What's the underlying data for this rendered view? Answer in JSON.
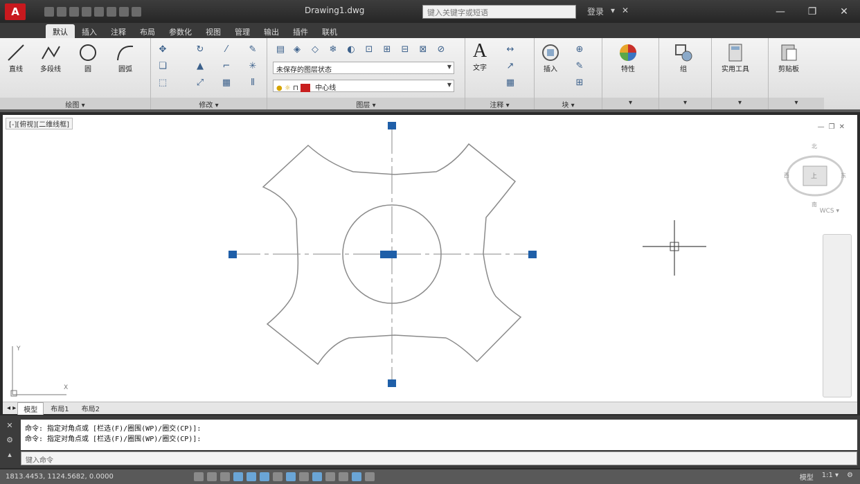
{
  "titlebar": {
    "app_logo": "A",
    "window_title": "Drawing1.dwg",
    "search_placeholder": "键入关键字或短语",
    "tools": [
      "登录",
      "▾",
      "✕"
    ],
    "controls": [
      "—",
      "❐",
      "✕"
    ]
  },
  "tabs": [
    {
      "label": "默认",
      "active": true
    },
    {
      "label": "插入",
      "active": false
    },
    {
      "label": "注释",
      "active": false
    },
    {
      "label": "布局",
      "active": false
    },
    {
      "label": "参数化",
      "active": false
    },
    {
      "label": "视图",
      "active": false
    },
    {
      "label": "管理",
      "active": false
    },
    {
      "label": "输出",
      "active": false
    },
    {
      "label": "插件",
      "active": false
    },
    {
      "label": "联机",
      "active": false
    }
  ],
  "ribbon": {
    "draw": {
      "title": "绘图 ▾",
      "line": "直线",
      "polyline": "多段线",
      "circle": "圆",
      "arc": "圆弧"
    },
    "modify": {
      "title": "修改 ▾"
    },
    "layers": {
      "title": "图层 ▾",
      "layer_combo": "未保存的图层状态",
      "current_layer": "中心线"
    },
    "annotation": {
      "title": "注释 ▾",
      "text": "文字"
    },
    "block": {
      "title": "块 ▾",
      "insert": "插入"
    },
    "properties": {
      "title": "▾",
      "label": "特性"
    },
    "groups": {
      "title": "▾",
      "label": "组"
    },
    "utilities": {
      "title": "▾",
      "label": "实用工具"
    },
    "clipboard": {
      "title": "▾",
      "label": "剪贴板"
    }
  },
  "canvas": {
    "viewport_label": "[-][俯视][二维线框]",
    "view_ctrls": [
      "—",
      "❐",
      "✕"
    ],
    "viewcube_top": "北",
    "viewcube_face": "上",
    "viewcube_bottom": "南",
    "viewcube_left": "西",
    "viewcube_right": "东",
    "wcs": "WCS ▾",
    "ucs_y": "Y",
    "ucs_x": "X"
  },
  "layout_tabs": [
    {
      "label": "模型",
      "active": true
    },
    {
      "label": "布局1",
      "active": false
    },
    {
      "label": "布局2",
      "active": false
    }
  ],
  "command": {
    "history": [
      "命令: 指定对角点或 [栏选(F)/圈围(WP)/圈交(CP)]:",
      "命令: 指定对角点或 [栏选(F)/圈围(WP)/圈交(CP)]:"
    ],
    "input_placeholder": "键入命令"
  },
  "statusbar": {
    "coords": "1813.4453, 1124.5682, 0.0000",
    "right": [
      "模型",
      "1:1 ▾",
      "⚙"
    ]
  },
  "colors": {
    "grip": "#1f5fa8",
    "geometry": "#8a8a8a",
    "ribbon_bg": "#e6e6e6",
    "titlebar_bg": "#2f2f2f"
  }
}
